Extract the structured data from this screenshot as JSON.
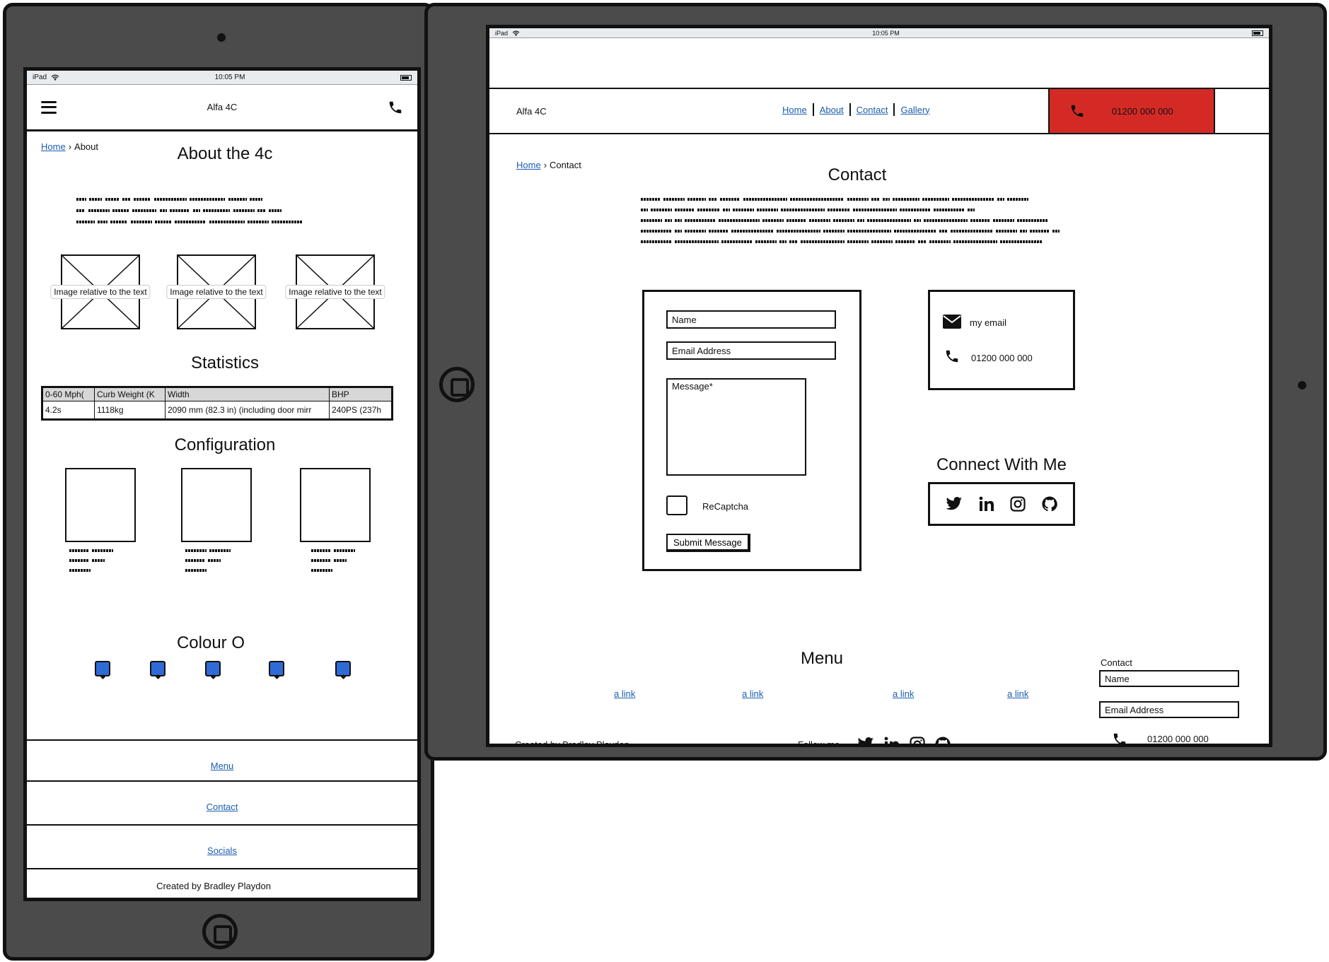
{
  "status_bar": {
    "device": "iPad",
    "time": "10:05 PM"
  },
  "portrait": {
    "brand": "Alfa 4C",
    "breadcrumb": {
      "home": "Home",
      "current": "About"
    },
    "title": "About the 4c",
    "image_caption": "Image relative to the text",
    "statistics": {
      "title": "Statistics",
      "headers": [
        "0-60 Mph(",
        "Curb Weight (K",
        "Width",
        "BHP"
      ],
      "row": [
        "4.2s",
        "1118kg",
        "2090 mm (82.3 in) (including door mirr",
        "240PS (237h"
      ]
    },
    "configuration_title": "Configuration",
    "colour_title": "Colour O",
    "footer": {
      "menu": "Menu",
      "contact": "Contact",
      "socials": "Socials",
      "credit": "Created by Bradley Playdon"
    }
  },
  "landscape": {
    "brand": "Alfa 4C",
    "nav": [
      "Home",
      "About",
      "Contact",
      "Gallery"
    ],
    "phone": "01200 000 000",
    "breadcrumb": {
      "home": "Home",
      "current": "Contact"
    },
    "title": "Contact",
    "form": {
      "name_placeholder": "Name",
      "email_placeholder": "Email Address",
      "message_placeholder": "Message*",
      "recaptcha": "ReCaptcha",
      "submit": "Submit Message"
    },
    "info": {
      "email": "my email",
      "phone": "01200 000 000"
    },
    "connect_title": "Connect With Me",
    "footer": {
      "menu_title": "Menu",
      "links": [
        "a link",
        "a link",
        "a link",
        "a link"
      ],
      "contact_title": "Contact",
      "name_placeholder": "Name",
      "email_placeholder": "Email Address",
      "phone": "01200 000 000",
      "credit": "Created by Bradley Playdon",
      "follow": "Follow me"
    }
  },
  "colors": {
    "device_frame": "#4b4b4b",
    "call_button": "#d42a26",
    "swatch": "#2f6bd7",
    "link": "#1a5db0"
  }
}
